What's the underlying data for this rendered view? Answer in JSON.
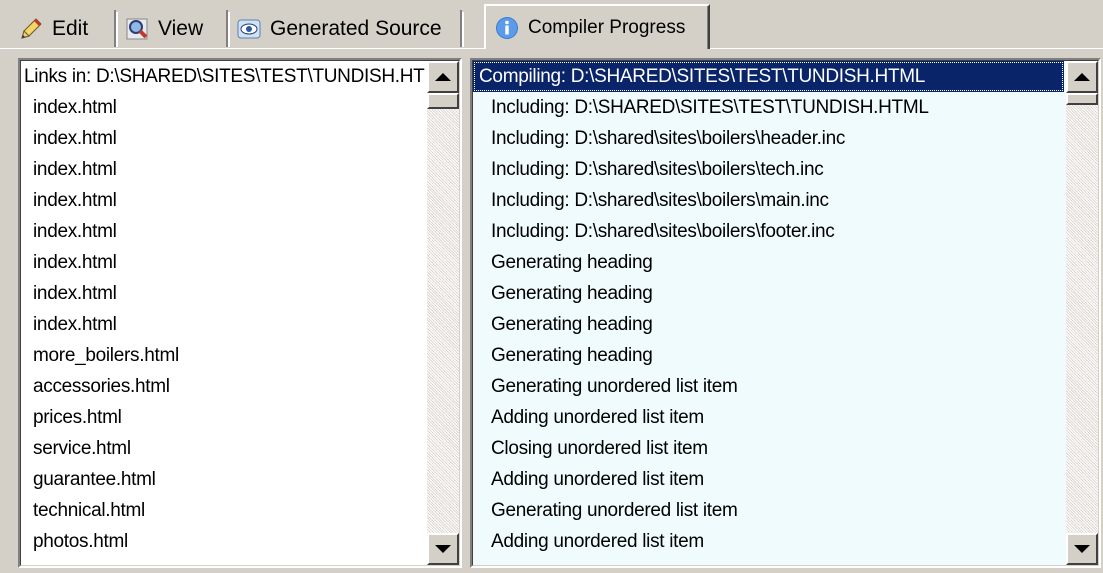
{
  "tabs": [
    {
      "label": "Edit",
      "icon": "pencil-icon"
    },
    {
      "label": "View",
      "icon": "magnifier-icon"
    },
    {
      "label": "Generated Source",
      "icon": "eye-icon"
    },
    {
      "label": "Compiler Progress",
      "icon": "info-icon",
      "active": true
    }
  ],
  "links_list": {
    "header": "Links in: D:\\SHARED\\SITES\\TEST\\TUNDISH.HTML",
    "items": [
      "index.html",
      "index.html",
      "index.html",
      "index.html",
      "index.html",
      "index.html",
      "index.html",
      "index.html",
      "more_boilers.html",
      "accessories.html",
      "prices.html",
      "service.html",
      "guarantee.html",
      "technical.html",
      "photos.html"
    ]
  },
  "progress_list": {
    "items": [
      "Compiling: D:\\SHARED\\SITES\\TEST\\TUNDISH.HTML",
      "Including: D:\\SHARED\\SITES\\TEST\\TUNDISH.HTML",
      "Including: D:\\shared\\sites\\boilers\\header.inc",
      "Including: D:\\shared\\sites\\boilers\\tech.inc",
      "Including: D:\\shared\\sites\\boilers\\main.inc",
      "Including: D:\\shared\\sites\\boilers\\footer.inc",
      "Generating heading",
      "Generating heading",
      "Generating heading",
      "Generating heading",
      "Generating unordered list item",
      "Adding unordered list item",
      "Closing unordered list item",
      "Adding unordered list item",
      "Generating unordered list item",
      "Adding unordered list item"
    ],
    "selected_index": 0
  },
  "colors": {
    "selection_bg": "#0a246a",
    "progress_bg": "#f0fbfd",
    "face": "#d4d0c8"
  }
}
